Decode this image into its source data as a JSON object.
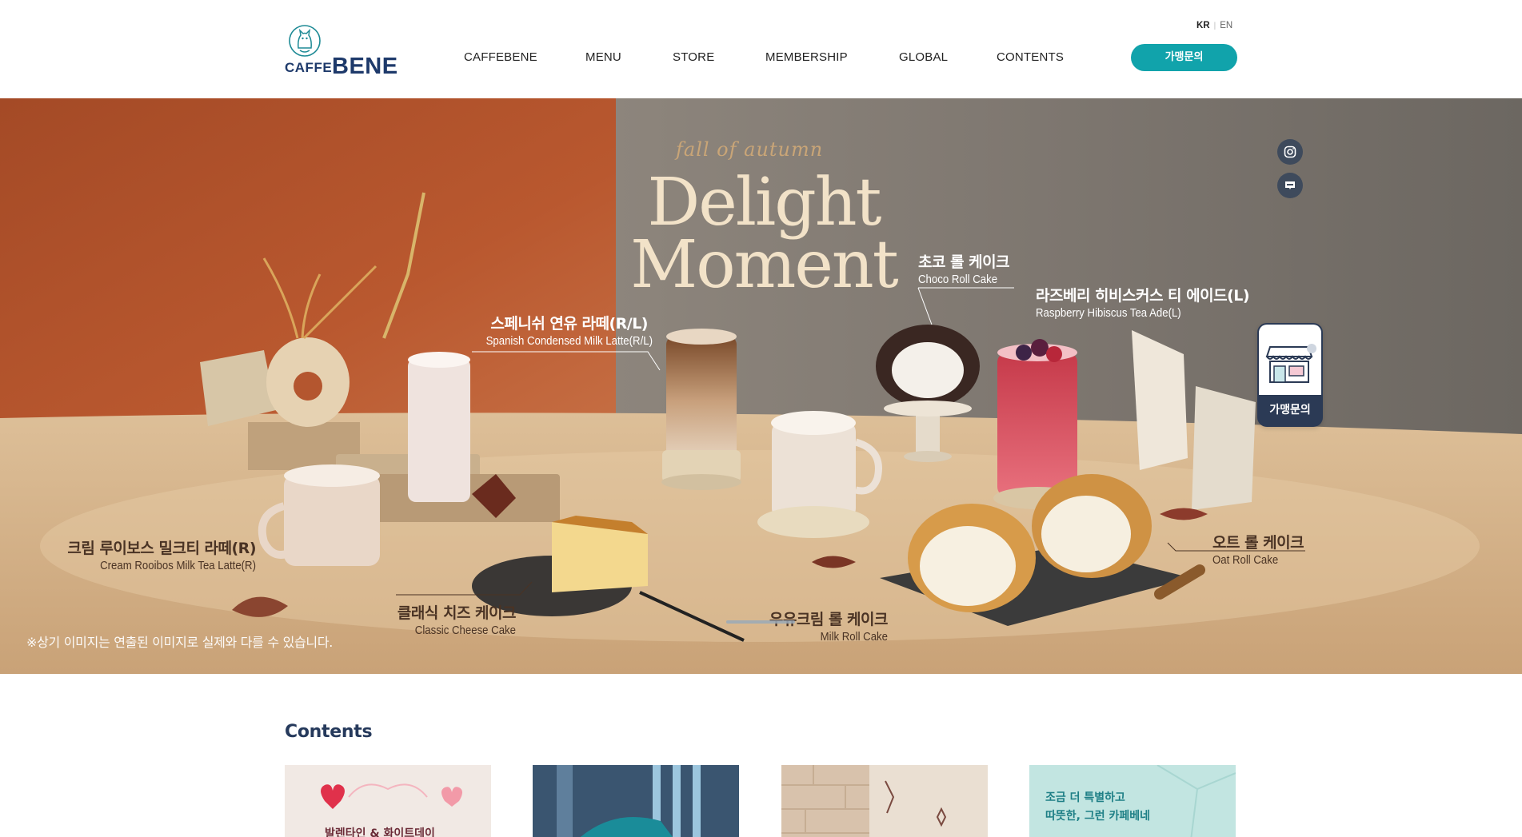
{
  "header": {
    "logo_caffe": "CAFFE",
    "logo_bene": "BENE",
    "nav": [
      "CAFFEBENE",
      "MENU",
      "STORE",
      "MEMBERSHIP",
      "GLOBAL",
      "CONTENTS"
    ],
    "lang_kr": "KR",
    "lang_en": "EN",
    "franchise_button": "가맹문의"
  },
  "hero": {
    "kicker": "fall of autumn",
    "title_line1": "Delight",
    "title_line2": "Moment",
    "products": [
      {
        "ko": "초코 롤 케이크",
        "en": "Choco Roll Cake"
      },
      {
        "ko": "라즈베리 히비스커스 티 에이드(L)",
        "en": "Raspberry Hibiscus Tea Ade(L)"
      },
      {
        "ko": "스페니쉬 연유 라떼(R/L)",
        "en": "Spanish Condensed Milk Latte(R/L)"
      },
      {
        "ko": "크림 루이보스 밀크티 라떼(R)",
        "en": "Cream Rooibos Milk Tea Latte(R)"
      },
      {
        "ko": "오트 롤 케이크",
        "en": "Oat Roll Cake"
      },
      {
        "ko": "클래식 치즈 케이크",
        "en": "Classic Cheese Cake"
      },
      {
        "ko": "우유크림 롤 케이크",
        "en": "Milk Roll Cake"
      }
    ],
    "disclaimer": "※상기 이미지는 연출된 이미지로 실제와 다를 수 있습니다."
  },
  "quick_menu": {
    "sns": [
      "instagram-icon",
      "blog-icon"
    ],
    "franchise_label": "가맹문의"
  },
  "contents": {
    "title": "Contents",
    "cards": [
      {
        "text": "발렌타인 & 화이트데이"
      },
      {
        "text": ""
      },
      {
        "text": ""
      },
      {
        "line1": "조금 더 특별하고",
        "line2": "따뜻한, 그런 카페베네"
      }
    ]
  },
  "colors": {
    "brand_navy": "#1e3a6b",
    "accent_teal": "#11a3ab",
    "hero_terracotta": "#b4562f",
    "hero_stone": "#8a8178",
    "hero_table": "#d8b993"
  }
}
